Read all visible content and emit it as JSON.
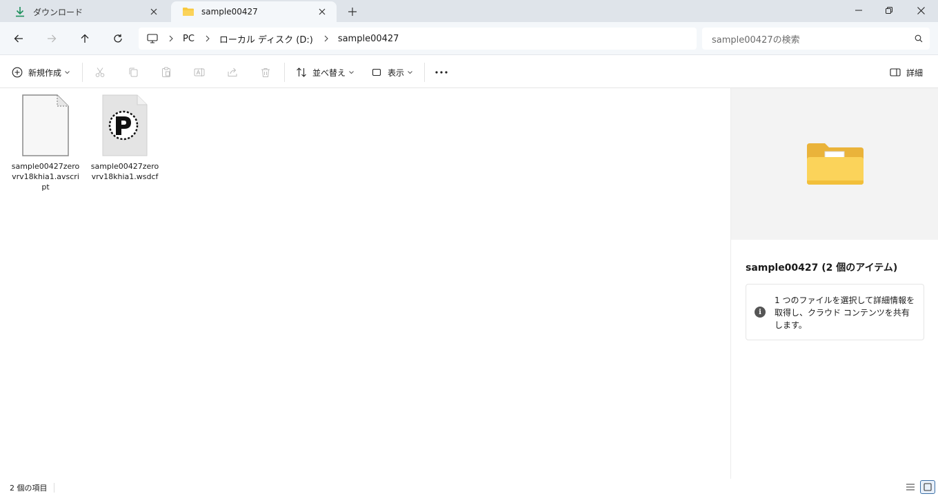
{
  "tabs": [
    {
      "label": "ダウンロード",
      "icon": "download-icon",
      "active": false
    },
    {
      "label": "sample00427",
      "icon": "folder-icon",
      "active": true
    }
  ],
  "address": {
    "crumbs": [
      "PC",
      "ローカル ディスク (D:)",
      "sample00427"
    ],
    "search_placeholder": "sample00427の検索"
  },
  "toolbar": {
    "new_label": "新規作成",
    "sort_label": "並べ替え",
    "view_label": "表示",
    "details_label": "詳細"
  },
  "files": [
    {
      "name": "sample00427zerovrv18khia1.avscript",
      "icon": "blank-file-icon"
    },
    {
      "name": "sample00427zerovrv18khia1.wsdcf",
      "icon": "media-file-icon"
    }
  ],
  "details": {
    "title": "sample00427 (2 個のアイテム)",
    "info": "1 つのファイルを選択して詳細情報を取得し、クラウド コンテンツを共有します。"
  },
  "status": {
    "count": "2 個の項目"
  },
  "colors": {
    "accent": "#3a6ea5",
    "folder": "#f8c93f",
    "download": "#1a8f5a"
  }
}
